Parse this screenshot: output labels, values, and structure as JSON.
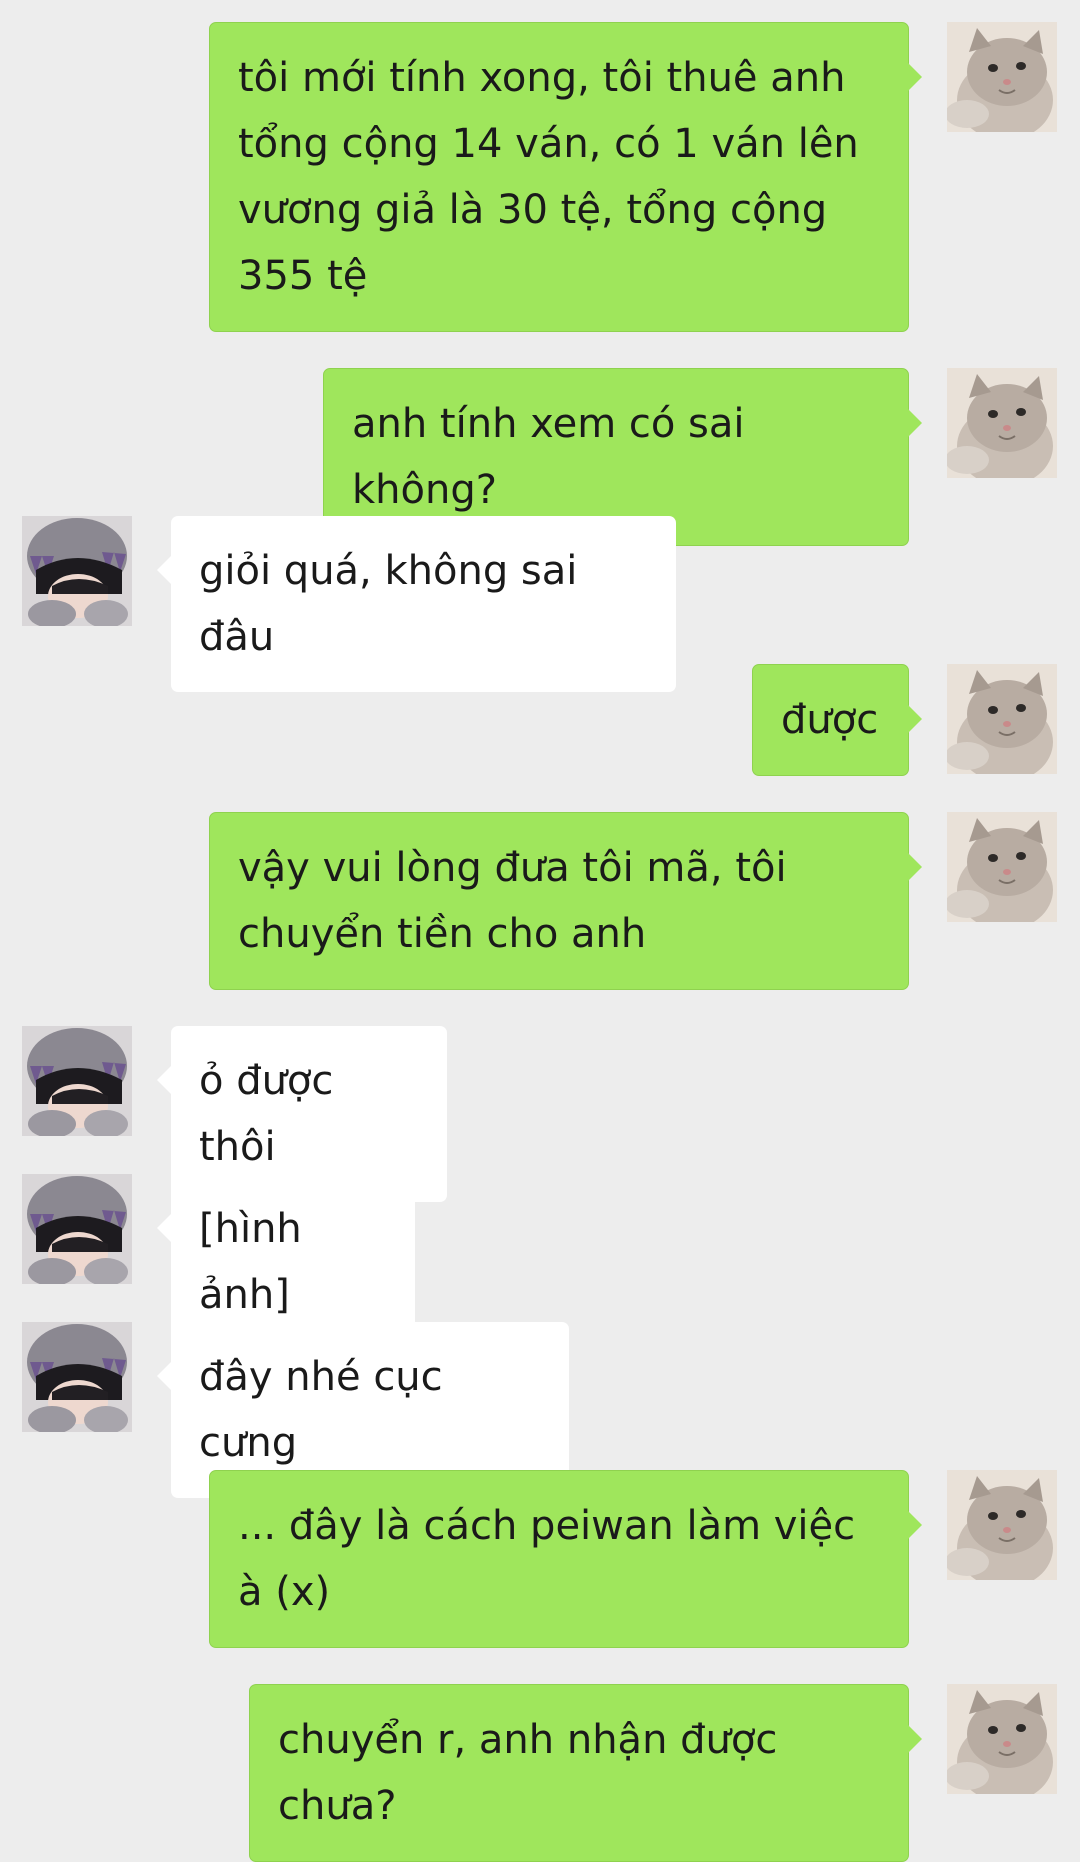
{
  "colors": {
    "background": "#ededed",
    "my_bubble": "#9fe65c",
    "their_bubble": "#ffffff",
    "text": "#1a1a1a"
  },
  "avatars": {
    "me": "cat-avatar-icon",
    "them": "person-hoodie-avatar-icon"
  },
  "messages": [
    {
      "sender": "me",
      "text": "tôi mới tính xong, tôi thuê anh tổng cộng 14 ván, có 1 ván lên vương giả là 30 tệ, tổng cộng 355 tệ"
    },
    {
      "sender": "me",
      "text": "anh tính xem có sai không?"
    },
    {
      "sender": "them",
      "text": "giỏi quá, không sai đâu"
    },
    {
      "sender": "me",
      "text": "được"
    },
    {
      "sender": "me",
      "text": "vậy vui lòng đưa tôi mã, tôi chuyển tiền cho anh"
    },
    {
      "sender": "them",
      "text": "ỏ được thôi"
    },
    {
      "sender": "them",
      "text": "[hình ảnh]"
    },
    {
      "sender": "them",
      "text": "đây nhé cục cưng"
    },
    {
      "sender": "me",
      "text": "... đây là cách peiwan làm việc à (x)"
    },
    {
      "sender": "me",
      "text": "chuyển r, anh nhận được chưa?"
    }
  ]
}
